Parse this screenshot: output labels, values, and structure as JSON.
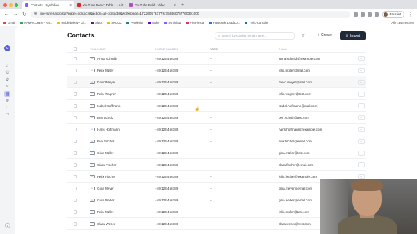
{
  "browser": {
    "tabs": [
      {
        "label": "Contacts | Synthflow",
        "active": true,
        "color": "#7b61ff"
      },
      {
        "label": "YouTube Demo: Table 1 - Airt",
        "active": false,
        "color": "#e02424"
      },
      {
        "label": "YouTube Build | Video",
        "active": false,
        "color": "#b44dc4"
      }
    ],
    "new_tab": "+",
    "url": "fine-tuner.ai/portal?page=contacts&action=all-contacts&workspace=1722605763779x753860767760391600",
    "profile_name": "Pausiert"
  },
  "bookmarks": [
    {
      "label": "Gmail",
      "color": "#ea4335"
    },
    {
      "label": "NAMAKCHEN – Go...",
      "color": "#34a853"
    },
    {
      "label": "Mobilebeiktiv - Gi...",
      "color": "#fbbc05"
    },
    {
      "label": "Slack",
      "color": "#611f69"
    },
    {
      "label": "SKOOL",
      "color": "#f4b400"
    },
    {
      "label": "Perplexity",
      "color": "#20808d"
    },
    {
      "label": "Make",
      "color": "#6d00cc"
    },
    {
      "label": "Synthflow",
      "color": "#7b61ff"
    },
    {
      "label": "FireFlies.ai",
      "color": "#e0306d"
    },
    {
      "label": "Facebook Lead Lo...",
      "color": "#1877f2"
    },
    {
      "label": "Trello-Console",
      "color": "#0079bf"
    }
  ],
  "bookmarks_right": "Alle Lesezeichen",
  "rail": {
    "logo": "M",
    "items": [
      {
        "name": "home-icon",
        "glyph": "⌂",
        "active": false
      },
      {
        "name": "phone-icon",
        "glyph": "☏",
        "active": false
      },
      {
        "name": "workflow-icon",
        "glyph": "⚙",
        "active": false
      },
      {
        "name": "sparkle-icon",
        "glyph": "✧",
        "active": false
      },
      {
        "name": "contacts-icon",
        "glyph": "▤",
        "active": true
      },
      {
        "name": "globe-icon",
        "glyph": "◍",
        "active": false
      },
      {
        "name": "chat-icon",
        "glyph": "◌",
        "active": false
      },
      {
        "name": "book-icon",
        "glyph": "▭",
        "active": false
      }
    ],
    "bottom": "L"
  },
  "page": {
    "title": "Contacts",
    "search_placeholder": "Search by number, email, name...",
    "create_label": "Create",
    "import_label": "Import"
  },
  "table": {
    "headers": [
      "FULL NAME",
      "PHONE NUMBER",
      "TAGS",
      "EMAIL"
    ],
    "rows": [
      {
        "name": "Anna Schmidt",
        "phone": "+49 123 456789",
        "tags": "–",
        "email": "anna.schmidt@example.com"
      },
      {
        "name": "Felix Müller",
        "phone": "+49 123 456789",
        "tags": "–",
        "email": "felix.müller@mail.com"
      },
      {
        "name": "David Meyer",
        "phone": "+49 123 456789",
        "tags": "–",
        "email": "david.meyer@mail.com"
      },
      {
        "name": "Felix Wagner",
        "phone": "+49 123 456789",
        "tags": "–",
        "email": "felix.wagner@test.com"
      },
      {
        "name": "Isabel Hoffmann",
        "phone": "+49 123 456789",
        "tags": "–",
        "email": "isabel.hoffmann@mail.com"
      },
      {
        "name": "Ben Schulz",
        "phone": "+49 123 456789",
        "tags": "–",
        "email": "ben.schulz@test.com"
      },
      {
        "name": "Hans Hoffmann",
        "phone": "+49 123 456789",
        "tags": "–",
        "email": "hans.hoffmann@example.com"
      },
      {
        "name": "Eva Fischer",
        "phone": "+49 123 456789",
        "tags": "–",
        "email": "eva.fischer@email.com"
      },
      {
        "name": "Gina Müller",
        "phone": "+49 123 456789",
        "tags": "–",
        "email": "gina.müller@test.com"
      },
      {
        "name": "Clara Fischer",
        "phone": "+49 123 456789",
        "tags": "–",
        "email": "clara.fischer@email.com"
      },
      {
        "name": "Felix Fischer",
        "phone": "+49 123 456789",
        "tags": "–",
        "email": "felix.fischer@example.com"
      },
      {
        "name": "Gina Meyer",
        "phone": "+49 123 456789",
        "tags": "–",
        "email": "gina.meyer@email.com"
      },
      {
        "name": "Gina Weber",
        "phone": "+49 123 456789",
        "tags": "–",
        "email": "gina.weber@email.com"
      },
      {
        "name": "Felix Müller",
        "phone": "+49 123 456789",
        "tags": "–",
        "email": "felix.müller@test.com"
      },
      {
        "name": "Clara Weber",
        "phone": "+49 123 456789",
        "tags": "–",
        "email": "clara.weber@test.com"
      }
    ],
    "hover_row": 2,
    "more_glyph": "···"
  }
}
